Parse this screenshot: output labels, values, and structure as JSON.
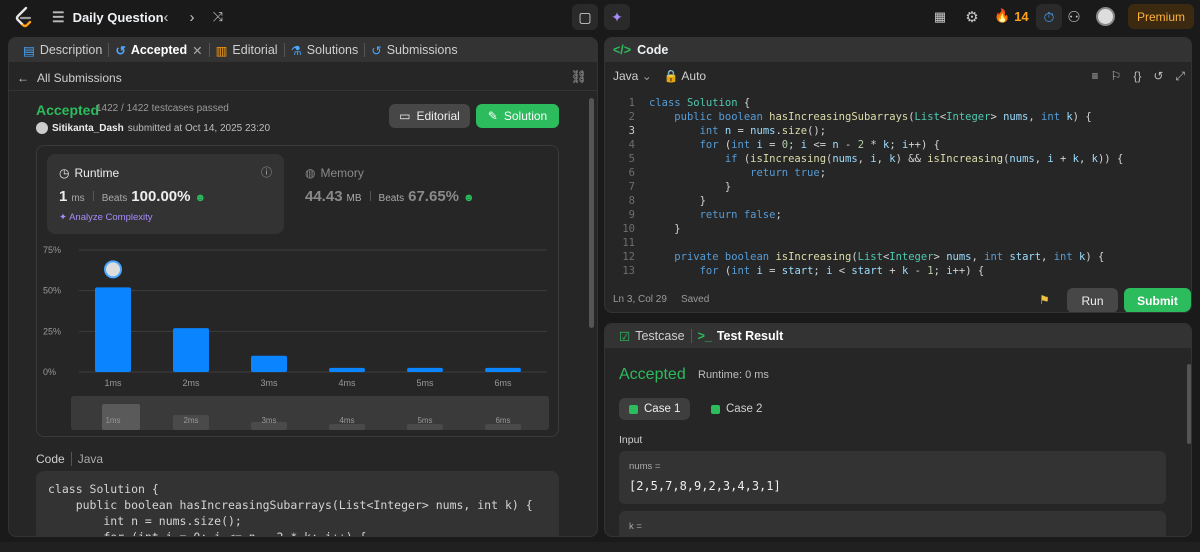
{
  "nav": {
    "title": "Daily Question",
    "streak": "14",
    "premium": "Premium"
  },
  "left_panel": {
    "tabs": [
      {
        "label": "Description"
      },
      {
        "label": "Accepted"
      },
      {
        "label": "Editorial"
      },
      {
        "label": "Solutions"
      },
      {
        "label": "Submissions"
      }
    ],
    "all_submissions": "All Submissions",
    "status": "Accepted",
    "testcases": "1422 / 1422 testcases passed",
    "user": "Sitikanta_Dash",
    "submitted_text": "submitted at Oct 14, 2025 23:20",
    "editorial_btn": "Editorial",
    "solution_btn": "Solution",
    "runtime": {
      "title": "Runtime",
      "value": "1",
      "unit": "ms",
      "beats_label": "Beats",
      "beats": "100.00%",
      "analyze": "Analyze Complexity"
    },
    "memory": {
      "title": "Memory",
      "value": "44.43",
      "unit": "MB",
      "beats_label": "Beats",
      "beats": "67.65%"
    },
    "code_label": "Code",
    "code_lang": "Java",
    "code_lines": [
      "class Solution {",
      "    public boolean hasIncreasingSubarrays(List<Integer> nums, int k) {",
      "        int n = nums.size();",
      "        for (int i = 0; i <= n - 2 * k; i++) {"
    ]
  },
  "chart_data": {
    "type": "bar",
    "categories": [
      "1ms",
      "2ms",
      "3ms",
      "4ms",
      "5ms",
      "6ms"
    ],
    "values": [
      52,
      27,
      10,
      2.5,
      2.5,
      2.5
    ],
    "yticks": [
      "75%",
      "50%",
      "25%",
      "0%"
    ],
    "ylim": [
      0,
      75
    ],
    "bar_color": "#0a84ff",
    "grid": true
  },
  "editor": {
    "title": "Code",
    "lang": "Java",
    "auto": "Auto",
    "status_pos": "Ln 3, Col 29",
    "status_saved": "Saved",
    "run": "Run",
    "submit": "Submit"
  },
  "result": {
    "tab_testcase": "Testcase",
    "tab_result": "Test Result",
    "status": "Accepted",
    "runtime": "Runtime: 0 ms",
    "case1": "Case 1",
    "case2": "Case 2",
    "input_label": "Input",
    "var1_name": "nums =",
    "var1_value": "[2,5,7,8,9,2,3,4,3,1]",
    "var2_name": "k ="
  }
}
